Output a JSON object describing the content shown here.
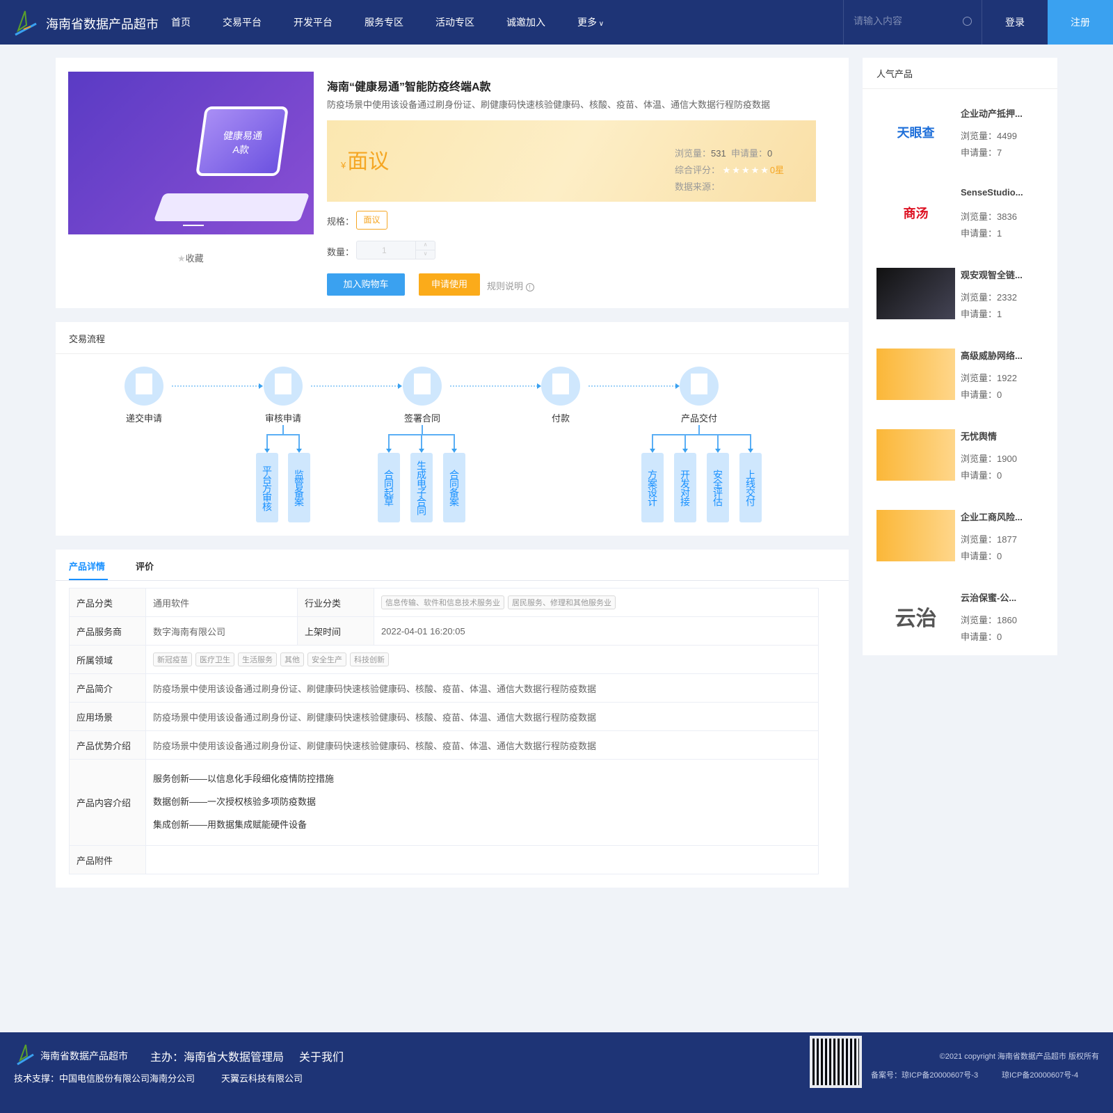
{
  "header": {
    "brand": "海南省数据产品超市",
    "nav": [
      "首页",
      "交易平台",
      "开发平台",
      "服务专区",
      "活动专区",
      "诚邀加入",
      "更多"
    ],
    "search_placeholder": "请输入内容",
    "login": "登录",
    "register": "注册"
  },
  "product": {
    "image_text": "健康易通",
    "image_subtext": "A款",
    "favorite": "收藏",
    "title": "海南“健康易通”智能防疫终端A款",
    "desc": "防疫场景中使用该设备通过刷身份证、刷健康码快速核验健康码、核酸、疫苗、体温、通信大数据行程防疫数据",
    "currency": "¥",
    "price": "面议",
    "views_label": "浏览量：",
    "views": "531",
    "applies_label": "申请量：",
    "applies": "0",
    "rating_label": "综合评分：",
    "rating": "0星",
    "rating_value": 0,
    "source_label": "数据来源：",
    "spec_label": "规格：",
    "spec": "面议",
    "qty_label": "数量：",
    "qty": "1",
    "cart_btn": "加入购物车",
    "apply_btn": "申请使用",
    "rules": "规则说明"
  },
  "process": {
    "title": "交易流程",
    "steps": [
      {
        "label": "递交申请",
        "sub": []
      },
      {
        "label": "审核申请",
        "sub": [
          "平台方审核",
          "监管备案"
        ]
      },
      {
        "label": "签署合同",
        "sub": [
          "合同起草",
          "生成电子合同",
          "合同备案"
        ]
      },
      {
        "label": "付款",
        "sub": []
      },
      {
        "label": "产品交付",
        "sub": [
          "方案设计",
          "开发对接",
          "安全评估",
          "上线交付"
        ]
      }
    ]
  },
  "details": {
    "tabs": [
      "产品详情",
      "评价"
    ],
    "category_label": "产品分类",
    "category": "通用软件",
    "industry_label": "行业分类",
    "industry": [
      "信息传输、软件和信息技术服务业",
      "居民服务、修理和其他服务业"
    ],
    "provider_label": "产品服务商",
    "provider": "数字海南有限公司",
    "listed_label": "上架时间",
    "listed": "2022-04-01 16:20:05",
    "domain_label": "所属领域",
    "domains": [
      "新冠疫苗",
      "医疗卫生",
      "生活服务",
      "其他",
      "安全生产",
      "科技创新"
    ],
    "intro_label": "产品简介",
    "intro": "防疫场景中使用该设备通过刷身份证、刷健康码快速核验健康码、核酸、疫苗、体温、通信大数据行程防疫数据",
    "scene_label": "应用场景",
    "scene": "防疫场景中使用该设备通过刷身份证、刷健康码快速核验健康码、核酸、疫苗、体温、通信大数据行程防疫数据",
    "adv_label": "产品优势介绍",
    "adv": "防疫场景中使用该设备通过刷身份证、刷健康码快速核验健康码、核酸、疫苗、体温、通信大数据行程防疫数据",
    "content_label": "产品内容介绍",
    "content": [
      "服务创新——以信息化手段细化疫情防控措施",
      "数据创新——一次授权核验多项防疫数据",
      "集成创新——用数据集成赋能硬件设备"
    ],
    "attach_label": "产品附件"
  },
  "popular": {
    "title": "人气产品",
    "views_label": "浏览量：",
    "applies_label": "申请量：",
    "items": [
      {
        "name": "企业动产抵押...",
        "views": "4499",
        "applies": "7",
        "logo": "天眼查"
      },
      {
        "name": "SenseStudio...",
        "views": "3836",
        "applies": "1",
        "logo": "商汤"
      },
      {
        "name": "观安观智全链...",
        "views": "2332",
        "applies": "1",
        "logo": ""
      },
      {
        "name": "高级威胁网络...",
        "views": "1922",
        "applies": "0",
        "logo": ""
      },
      {
        "name": "无忧舆情",
        "views": "1900",
        "applies": "0",
        "logo": ""
      },
      {
        "name": "企业工商风险...",
        "views": "1877",
        "applies": "0",
        "logo": ""
      },
      {
        "name": "云治保蜜-公...",
        "views": "1860",
        "applies": "0",
        "logo": "云治"
      }
    ]
  },
  "footer": {
    "brand": "海南省数据产品超市",
    "host": "主办：",
    "host_org": "海南省大数据管理局",
    "about": "关于我们",
    "support": "技术支撑：中国电信股份有限公司海南分公司",
    "support2": "天翼云科技有限公司",
    "copyright": "©2021 copyright 海南省数据产品超市 版权所有",
    "icp": "备案号：琼ICP备20000607号-3",
    "icp2": "琼ICP备20000607号-4"
  }
}
